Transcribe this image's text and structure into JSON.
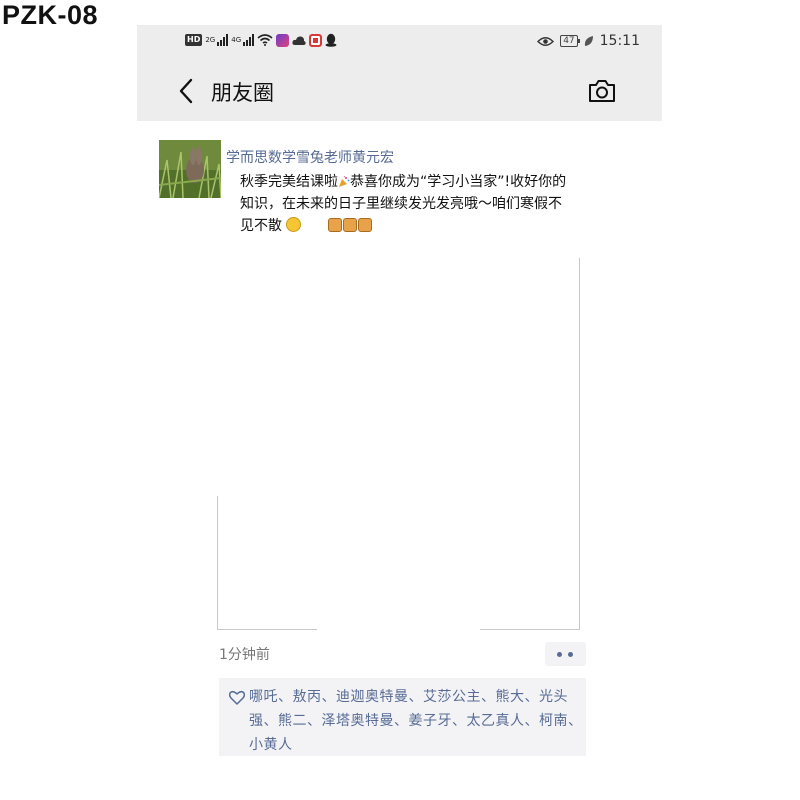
{
  "corner_label": "PZK-08",
  "status_bar": {
    "hd": "HD",
    "net1": "2G",
    "net2": "4G",
    "battery": "47",
    "time": "15:11"
  },
  "nav": {
    "title": "朋友圈"
  },
  "post": {
    "author": "学而思数学雪兔老师黄元宏",
    "text_part1": "秋季完美结课啦",
    "text_part2": "恭喜你成为“学习小当家”!收好你的知识，在未来的日子里继续发光发亮哦～咱们寒假不见不散",
    "time_ago": "1分钟前"
  },
  "likes": {
    "names": "哪吒、敖丙、迪迦奥特曼、艾莎公主、熊大、光头强、熊二、泽塔奥特曼、姜子牙、太乙真人、柯南、小黄人"
  },
  "colors": {
    "bar_bg": "#ededed",
    "link_blue": "#576b95",
    "likes_bg": "#f3f3f5"
  }
}
